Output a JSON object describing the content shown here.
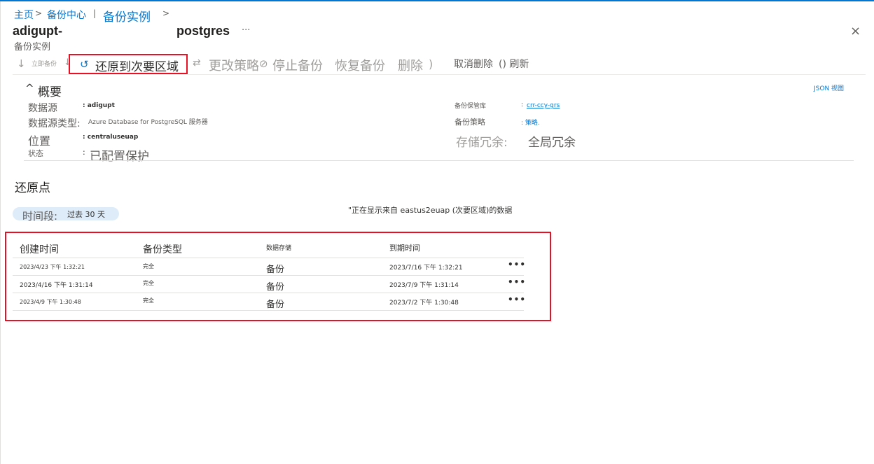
{
  "breadcrumb": {
    "home": "主页",
    "sep1": ">",
    "center": "备份中心",
    "sep2": "|",
    "current": "备份实例",
    "sep3": ">"
  },
  "header": {
    "title_prefix": "adigupt-",
    "title_suffix": "postgres",
    "more": "···",
    "subtitle": "备份实例",
    "close": "×"
  },
  "toolbar": {
    "backup_now_icon": "↓",
    "backup_now": "立即备份",
    "backup_now_caret": "↓",
    "restore_secondary_icon": "↺",
    "restore_secondary": "还原到次要区域",
    "change_policy_icon": "⇄",
    "change_policy": "更改策略",
    "stop_backup_icon": "⊘",
    "stop_backup": "停止备份",
    "resume_backup": "恢复备份",
    "delete": "删除",
    "delete_paren": ")",
    "undelete": "取消删除",
    "refresh": "() 刷新"
  },
  "essentials": {
    "heading_icon": "^",
    "heading": "概要",
    "json_view": "JSON 视图",
    "left": [
      {
        "label": "数据源",
        "value": ": adigupt"
      },
      {
        "label": "数据源类型:",
        "value": "Azure Database for PostgreSQL 服务器"
      },
      {
        "label": "位置",
        "value": ": centraluseuap"
      },
      {
        "label": "状态",
        "value": "已配置保护",
        "colon": ":"
      }
    ],
    "right": {
      "vault_label": "备份保管库",
      "vault_colon": ":",
      "vault_value": "crr-ccy-grs",
      "policy_label": "备份策略",
      "policy_value": ": 策略.",
      "redundancy_label": "存储冗余:",
      "redundancy_value": "全局冗余"
    }
  },
  "restore_points": {
    "title": "还原点",
    "time_period_label": "时间段:",
    "time_period_value": "过去 30 天",
    "notice": "\"正在显示来自 eastus2euap (次要区域)的数据",
    "columns": [
      "创建时间",
      "备份类型",
      "数据存储",
      "到期时间"
    ],
    "rows": [
      {
        "created": "2023/4/23 下午 1:32:21",
        "type": "完全",
        "store": "备份",
        "expiry": "2023/7/16 下午 1:32:21",
        "menu": "•••"
      },
      {
        "created": "2023/4/16 下午 1:31:14",
        "type": "完全",
        "store": "备份",
        "expiry": "2023/7/9 下午 1:31:14",
        "menu": "•••"
      },
      {
        "created": "2023/4/9 下午 1:30:48",
        "type": "完全",
        "store": "备份",
        "expiry": "2023/7/2 下午 1:30:48",
        "menu": "•••"
      }
    ]
  },
  "colors": {
    "accent": "#0078d4",
    "highlight_border": "#e81123",
    "pill_bg": "#deecf9"
  }
}
